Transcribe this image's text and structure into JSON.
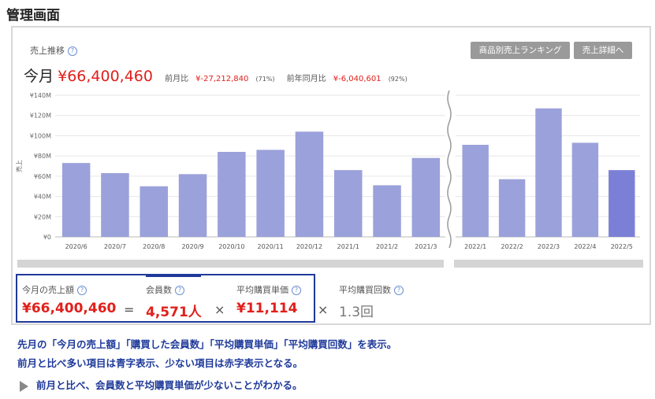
{
  "page": {
    "title": "管理画面"
  },
  "panel": {
    "section_label": "売上推移",
    "help_symbol": "?",
    "buttons": {
      "ranking": "商品別売上ランキング",
      "detail": "売上詳細へ"
    },
    "summary": {
      "label": "今月",
      "amount": "¥66,400,460",
      "prev_month_label": "前月比",
      "prev_month_value": "¥-27,212,840",
      "prev_month_pct": "(71%)",
      "prev_year_label": "前年同月比",
      "prev_year_value": "¥-6,040,601",
      "prev_year_pct": "(92%)"
    }
  },
  "chart_data": {
    "type": "bar",
    "ylabel": "売上",
    "ylim": [
      0,
      140
    ],
    "yticks": [
      "¥0",
      "¥20M",
      "¥40M",
      "¥60M",
      "¥80M",
      "¥100M",
      "¥120M",
      "¥140M"
    ],
    "bar_color": "#9ba1da",
    "highlight_color": "#7b80d6",
    "left": {
      "categories": [
        "2020/6",
        "2020/7",
        "2020/8",
        "2020/9",
        "2020/10",
        "2020/11",
        "2020/12",
        "2021/1",
        "2021/2",
        "2021/3"
      ],
      "values": [
        73,
        63,
        50,
        62,
        84,
        86,
        104,
        66,
        51,
        78
      ]
    },
    "right": {
      "categories": [
        "2022/1",
        "2022/2",
        "2022/3",
        "2022/4",
        "2022/5"
      ],
      "values": [
        91,
        57,
        127,
        93,
        66
      ],
      "highlight_index": 4
    }
  },
  "metrics": {
    "sales_label": "今月の売上額",
    "sales_value": "¥66,400,460",
    "eq": "=",
    "members_label": "会員数",
    "members_value": "4,571人",
    "times1": "×",
    "avg_price_label": "平均購買単価",
    "avg_price_value": "¥11,114",
    "times2": "×",
    "avg_count_label": "平均購買回数",
    "avg_count_value": "1.3回"
  },
  "notes": {
    "line1": "先月の「今月の売上額」「購買した会員数」「平均購買単価」「平均購買回数」を表示。",
    "line2": "前月と比べ多い項目は青字表示、少ない項目は赤字表示となる。",
    "line3": "前月と比べ、会員数と平均購買単価が少ないことがわかる。"
  }
}
